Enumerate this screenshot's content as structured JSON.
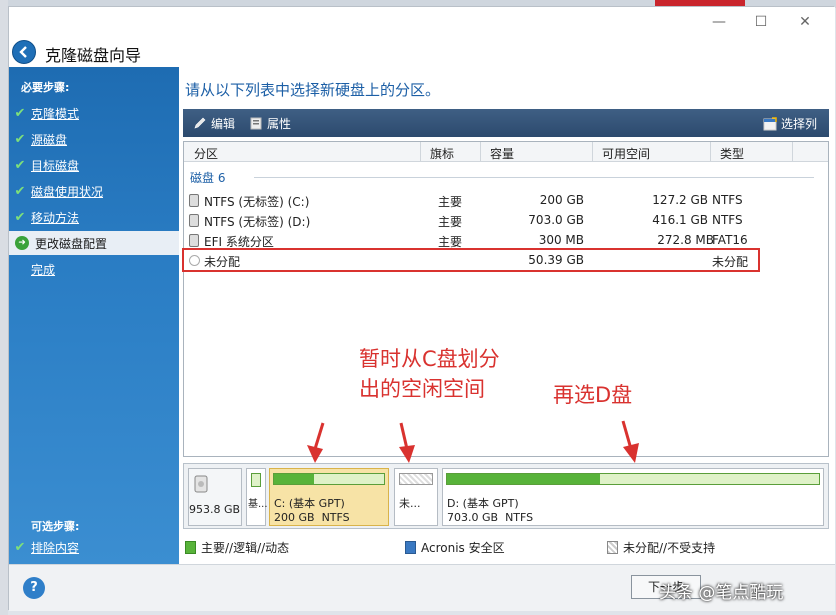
{
  "window": {
    "title": "克隆磁盘向导",
    "minimize": "—",
    "maximize": "☐",
    "close": "✕"
  },
  "sidebar": {
    "required_header": "必要步骤:",
    "items": [
      {
        "label": "克隆模式",
        "state": "done"
      },
      {
        "label": "源磁盘",
        "state": "done"
      },
      {
        "label": "目标磁盘",
        "state": "done"
      },
      {
        "label": "磁盘使用状况",
        "state": "done"
      },
      {
        "label": "移动方法",
        "state": "done"
      },
      {
        "label": "更改磁盘配置",
        "state": "active"
      },
      {
        "label": "完成",
        "state": "pending"
      }
    ],
    "optional_header": "可选步骤:",
    "optional_items": [
      {
        "label": "排除内容",
        "state": "done"
      }
    ]
  },
  "main": {
    "instruction": "请从以下列表中选择新硬盘上的分区。",
    "toolbar": {
      "edit": "编辑",
      "properties": "属性",
      "select_columns": "选择列"
    },
    "table": {
      "headers": [
        "分区",
        "旗标",
        "容量",
        "可用空间",
        "类型"
      ],
      "group": "磁盘 6",
      "rows": [
        {
          "name": "NTFS (无标签) (C:)",
          "flag": "主要",
          "capacity": "200 GB",
          "free": "127.2 GB",
          "type": "NTFS"
        },
        {
          "name": "NTFS (无标签) (D:)",
          "flag": "主要",
          "capacity": "703.0 GB",
          "free": "416.1 GB",
          "type": "NTFS"
        },
        {
          "name": "EFI 系统分区",
          "flag": "主要",
          "capacity": "300 MB",
          "free": "272.8 MB",
          "type": "FAT16"
        },
        {
          "name": "未分配",
          "flag": "",
          "capacity": "50.39 GB",
          "free": "",
          "type": "未分配"
        }
      ]
    },
    "disk_map": {
      "disk_size": "953.8 GB",
      "seg_small_label": "基...",
      "c_label": "C: (基本 GPT)",
      "c_size": "200 GB",
      "c_fs": "NTFS",
      "c_fill_fraction": 0.36,
      "unalloc_label": "未...",
      "d_label": "D: (基本 GPT)",
      "d_size": "703.0 GB",
      "d_fs": "NTFS",
      "d_fill_fraction": 0.41
    },
    "legend": {
      "primary": "主要//逻辑//动态",
      "acronis": "Acronis 安全区",
      "unallocated": "未分配//不受支持"
    }
  },
  "annotations": {
    "text1_line1": "暂时从C盘划分",
    "text1_line2": "出的空闲空间",
    "text2": "再选D盘"
  },
  "footer": {
    "help": "?",
    "next": "下一步",
    "watermark": "头条 @笔点酷玩"
  },
  "colors": {
    "accent": "#1c5fa6",
    "annotation_red": "#d9322f",
    "partition_green": "#58b33a",
    "selected_partition": "#f7e3a6"
  }
}
